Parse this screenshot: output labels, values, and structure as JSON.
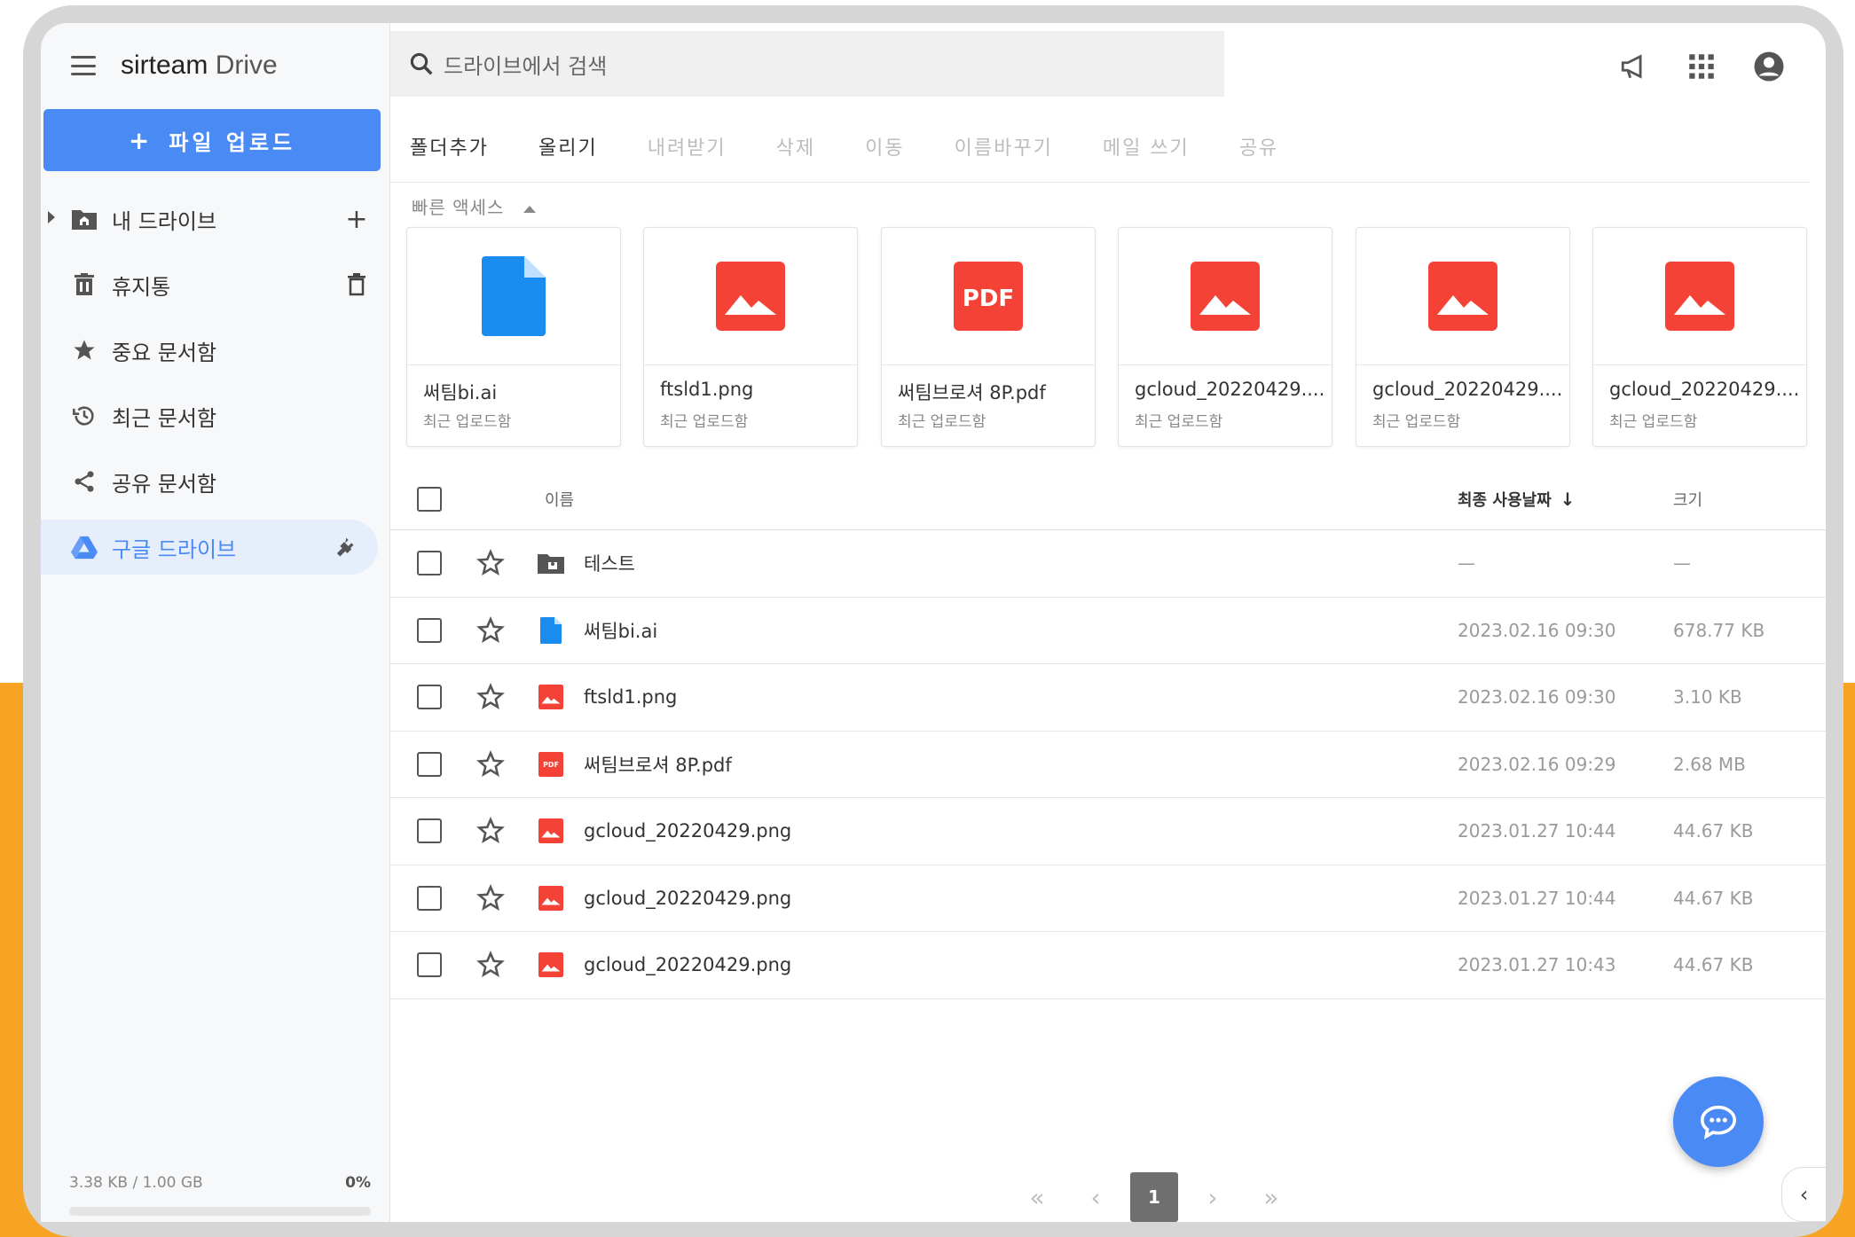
{
  "app": {
    "brand_bold": "sirteam",
    "brand_light": "Drive"
  },
  "search": {
    "placeholder": "드라이브에서 검색"
  },
  "sidebar": {
    "upload_label": "파일 업로드",
    "items": [
      {
        "label": "내 드라이브",
        "icon": "folder-home-icon",
        "trail": "plus-icon"
      },
      {
        "label": "휴지통",
        "icon": "trash-icon",
        "trail": "trash-outline-icon"
      },
      {
        "label": "중요 문서함",
        "icon": "star-icon"
      },
      {
        "label": "최근 문서함",
        "icon": "history-icon"
      },
      {
        "label": "공유 문서함",
        "icon": "share-icon"
      },
      {
        "label": "구글 드라이브",
        "icon": "google-drive-icon",
        "trail": "plug-icon",
        "active": true
      }
    ],
    "storage_used": "3.38 KB  /  1.00 GB",
    "storage_pct": "0%"
  },
  "toolbar": {
    "buttons": [
      {
        "label": "폴더추가",
        "enabled": true
      },
      {
        "label": "올리기",
        "enabled": true
      },
      {
        "label": "내려받기",
        "enabled": false
      },
      {
        "label": "삭제",
        "enabled": false
      },
      {
        "label": "이동",
        "enabled": false
      },
      {
        "label": "이름바꾸기",
        "enabled": false
      },
      {
        "label": "메일 쓰기",
        "enabled": false
      },
      {
        "label": "공유",
        "enabled": false
      }
    ]
  },
  "quick_access": {
    "label": "빠른 액세스",
    "cards": [
      {
        "name": "써팀bi.ai",
        "sub": "최근 업로드함",
        "type": "doc"
      },
      {
        "name": "ftsld1.png",
        "sub": "최근 업로드함",
        "type": "image"
      },
      {
        "name": "써팀브로셔 8P.pdf",
        "sub": "최근 업로드함",
        "type": "pdf"
      },
      {
        "name": "gcloud_20220429....",
        "sub": "최근 업로드함",
        "type": "image"
      },
      {
        "name": "gcloud_20220429....",
        "sub": "최근 업로드함",
        "type": "image"
      },
      {
        "name": "gcloud_20220429....",
        "sub": "최근 업로드함",
        "type": "image"
      }
    ]
  },
  "table": {
    "headers": {
      "name": "이름",
      "date": "최종 사용날짜",
      "size": "크기"
    },
    "rows": [
      {
        "name": "테스트",
        "date": "—",
        "size": "—",
        "type": "folder"
      },
      {
        "name": "써팀bi.ai",
        "date": "2023.02.16 09:30",
        "size": "678.77 KB",
        "type": "doc"
      },
      {
        "name": "ftsld1.png",
        "date": "2023.02.16 09:30",
        "size": "3.10 KB",
        "type": "image"
      },
      {
        "name": "써팀브로셔 8P.pdf",
        "date": "2023.02.16 09:29",
        "size": "2.68 MB",
        "type": "pdf"
      },
      {
        "name": "gcloud_20220429.png",
        "date": "2023.01.27 10:44",
        "size": "44.67 KB",
        "type": "image"
      },
      {
        "name": "gcloud_20220429.png",
        "date": "2023.01.27 10:44",
        "size": "44.67 KB",
        "type": "image"
      },
      {
        "name": "gcloud_20220429.png",
        "date": "2023.01.27 10:43",
        "size": "44.67 KB",
        "type": "image"
      }
    ]
  },
  "pagination": {
    "first": "«",
    "prev": "‹",
    "current": "1",
    "next": "›",
    "last": "»"
  },
  "colors": {
    "accent": "#4a8af4",
    "image_red": "#f44336",
    "doc_blue": "#1a8cf0",
    "background_orange": "#f7a324"
  }
}
